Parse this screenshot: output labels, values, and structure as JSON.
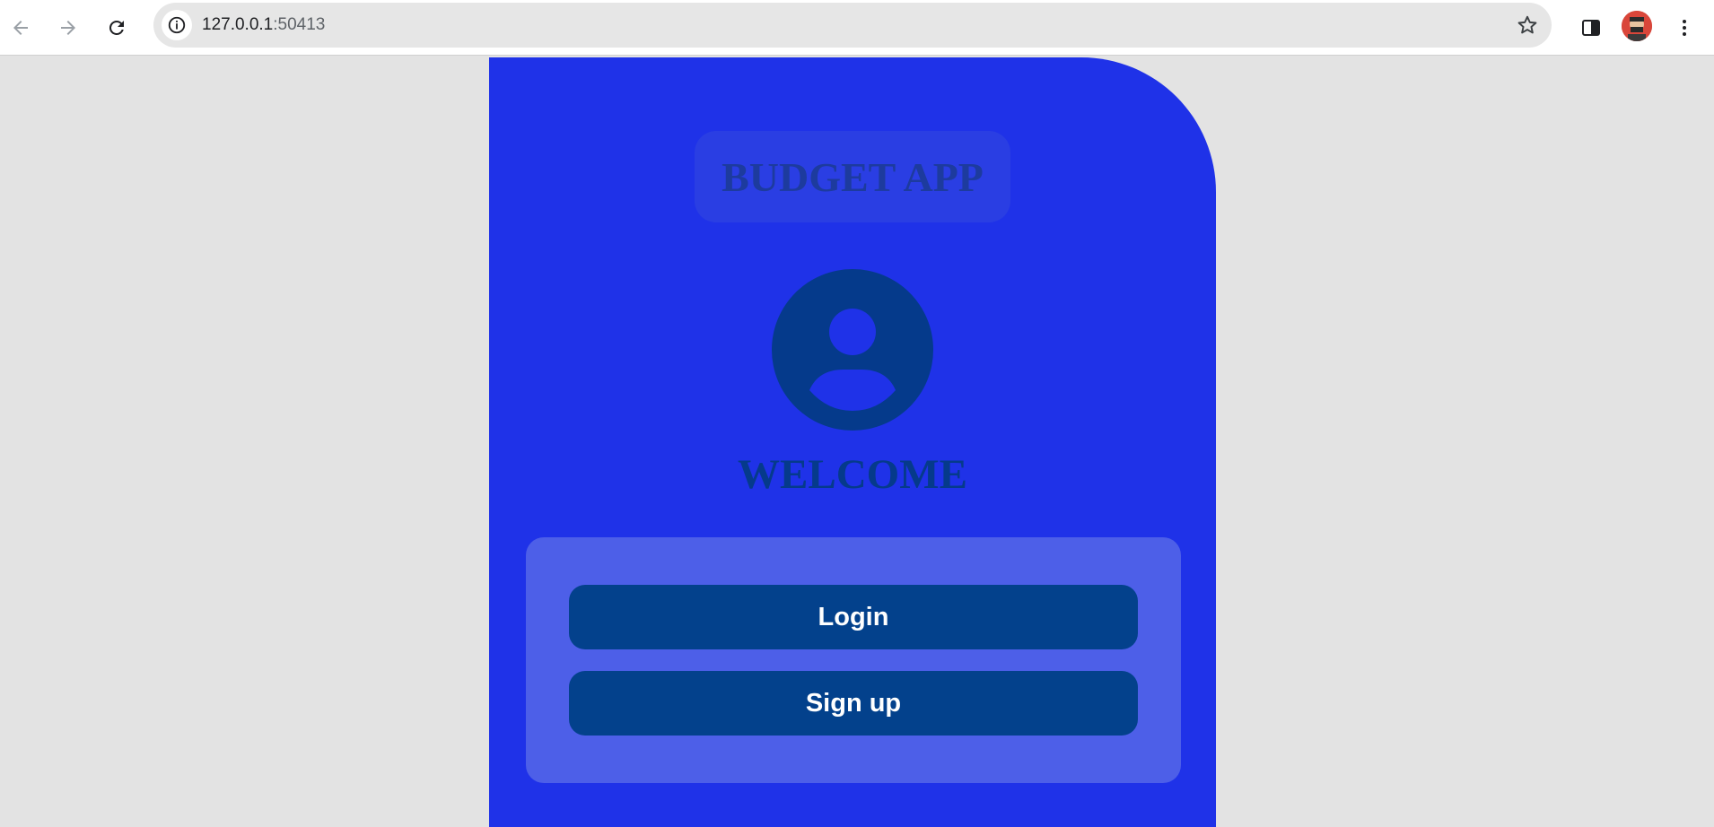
{
  "browser": {
    "url_host": "127.0.0.1",
    "url_port": ":50413",
    "icons": {
      "back": "back-arrow-icon",
      "forward": "forward-arrow-icon",
      "reload": "reload-icon",
      "info": "info-icon",
      "star": "star-icon",
      "side_panel": "side-panel-icon",
      "menu": "kebab-menu-icon"
    }
  },
  "app": {
    "title": "BUDGET APP",
    "welcome": "WELCOME",
    "login_label": "Login",
    "signup_label": "Sign up",
    "colors": {
      "panel": "#1f32e8",
      "title_box": "#2a3ee3",
      "card": "#4d5fe8",
      "button": "#03418c",
      "dark_text": "#053a8b",
      "page_bg": "#e3e3e3"
    }
  }
}
